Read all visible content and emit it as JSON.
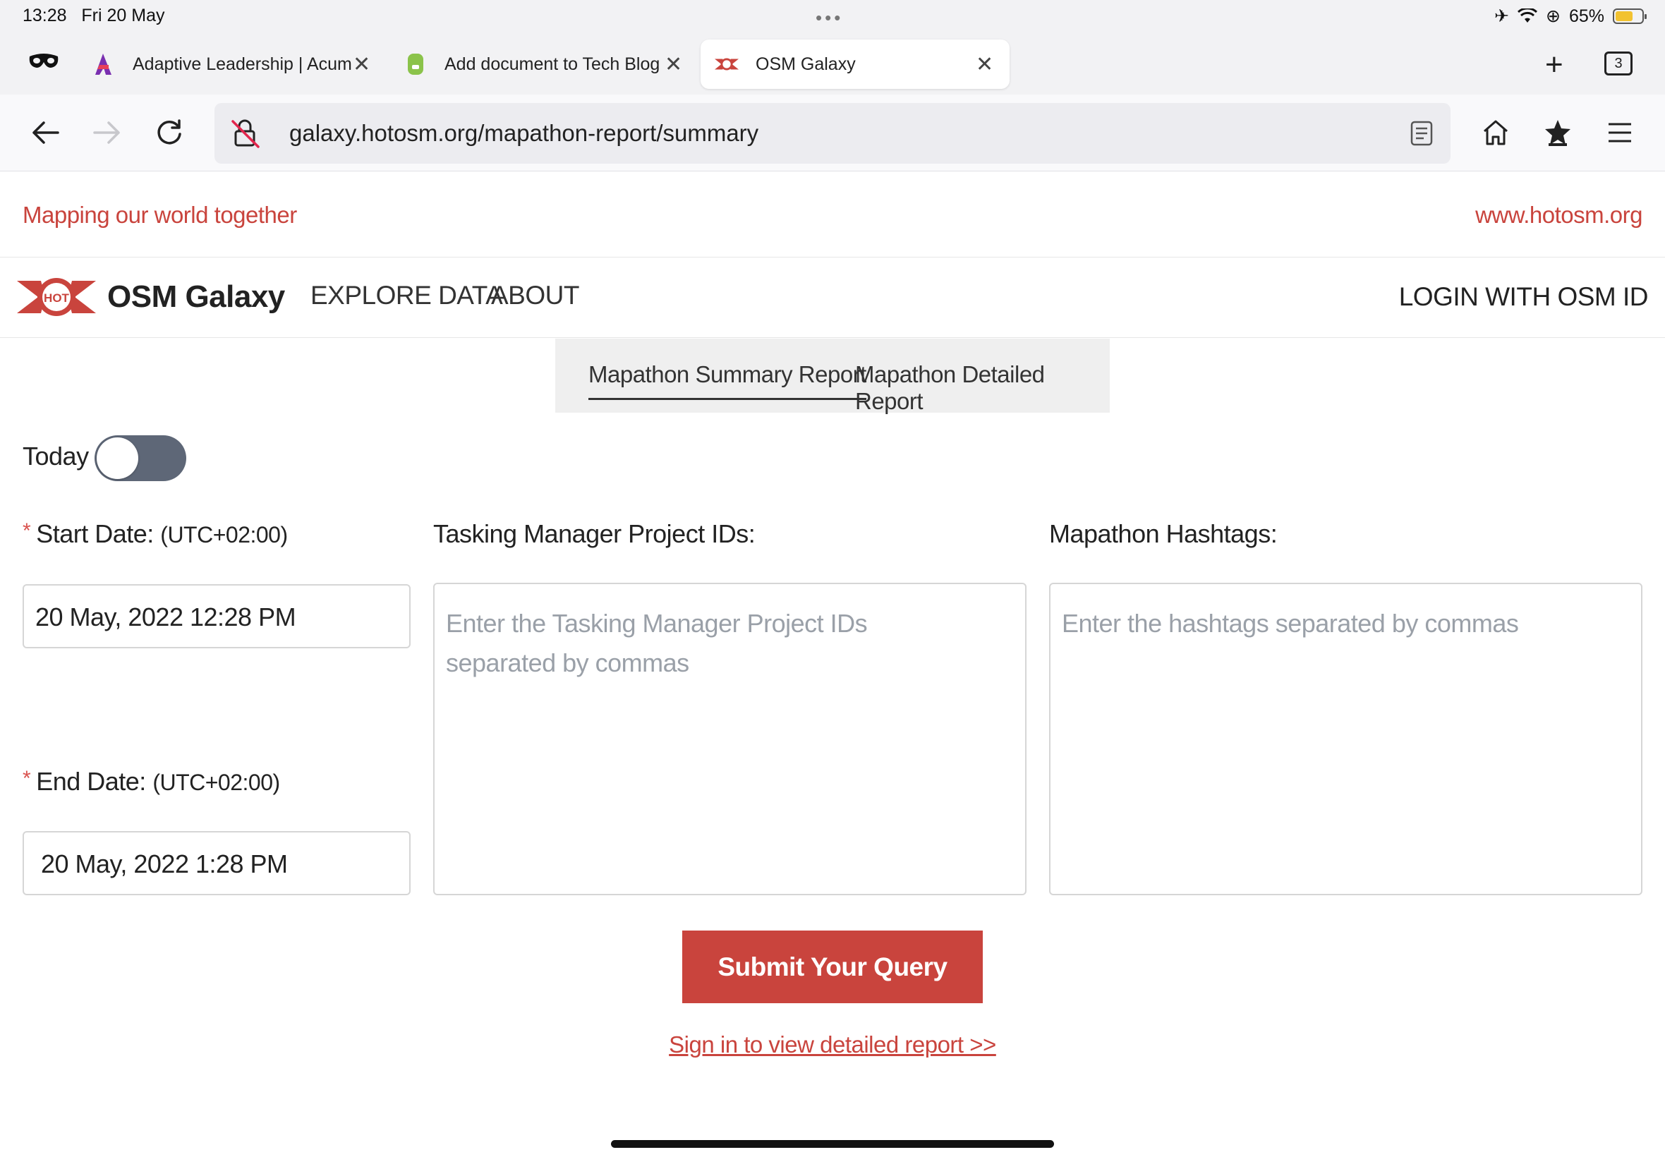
{
  "status_bar": {
    "time": "13:28",
    "date": "Fri 20 May",
    "battery": "65%"
  },
  "browser": {
    "tabs": [
      {
        "title": "Adaptive Leadership | Acum"
      },
      {
        "title": "Add document to Tech Blog"
      },
      {
        "title": "OSM Galaxy"
      }
    ],
    "tab_count": "3",
    "url": "galaxy.hotosm.org/mapathon-report/summary"
  },
  "page": {
    "tagline": "Mapping our world together",
    "site_link": "www.hotosm.org",
    "brand": {
      "logo_text": "HOT",
      "name": "OSM Galaxy"
    },
    "menu": {
      "explore": "EXPLORE DATA",
      "about": "ABOUT"
    },
    "login": "LOGIN WITH OSM ID",
    "report_tabs": {
      "summary": "Mapathon Summary Report",
      "detailed": "Mapathon Detailed Report"
    },
    "today_label": "Today",
    "start_date": {
      "label": "Start Date:",
      "tz": "(UTC+02:00)",
      "value": "20 May, 2022 12:28 PM"
    },
    "end_date": {
      "label": "End Date:",
      "tz": "(UTC+02:00)",
      "value": "20 May, 2022 1:28 PM"
    },
    "project_ids": {
      "label": "Tasking Manager Project IDs:",
      "placeholder": "Enter the Tasking Manager Project IDs separated by commas"
    },
    "hashtags": {
      "label": "Mapathon Hashtags:",
      "placeholder": "Enter the hashtags separated by commas"
    },
    "submit": "Submit Your Query",
    "signin": "Sign in to view detailed report >>"
  },
  "colors": {
    "brand_red": "#c9443d",
    "toggle_off": "#5e6777"
  }
}
